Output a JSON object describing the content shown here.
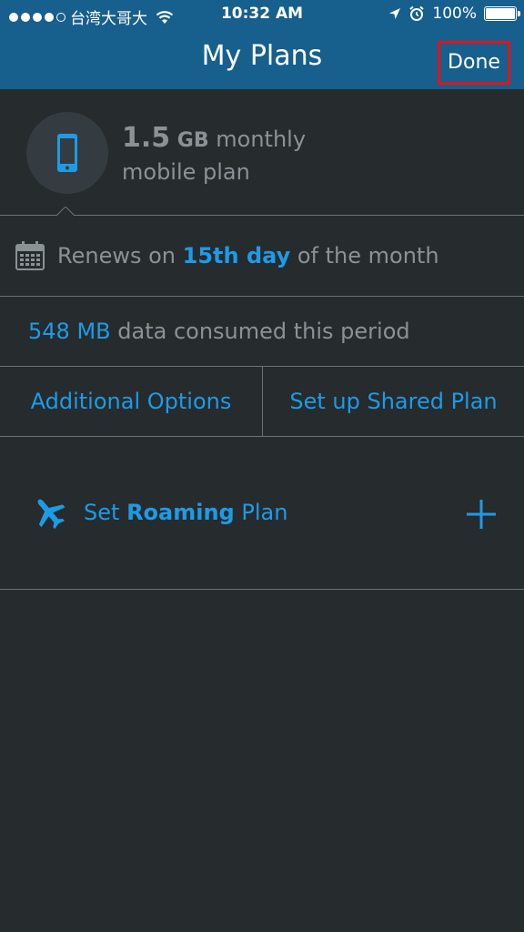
{
  "status_bar": {
    "carrier": "台湾大哥大",
    "time": "10:32 AM",
    "battery": "100%"
  },
  "nav": {
    "title": "My Plans",
    "done_label": "Done"
  },
  "plan": {
    "amount": "1.5",
    "unit": "GB",
    "monthly": "monthly",
    "line2": "mobile plan"
  },
  "renews": {
    "prefix": "Renews on",
    "day": "15th day",
    "suffix": "of the month"
  },
  "consumed": {
    "amount": "548 MB",
    "text": "data consumed this period"
  },
  "options": {
    "additional": "Additional Options",
    "shared": "Set up Shared Plan"
  },
  "roaming": {
    "prefix": "Set",
    "bold": "Roaming",
    "suffix": "Plan"
  },
  "colors": {
    "nav_bg": "#175f8c",
    "body_bg": "#262b2e",
    "accent": "#1e9be6",
    "highlight_border": "#e0141d"
  },
  "icons": {
    "phone": "smartphone-icon",
    "calendar": "calendar-icon",
    "plane": "airplane-icon",
    "plus": "plus-icon",
    "wifi": "wifi-icon",
    "location": "location-arrow-icon",
    "alarm": "alarm-icon",
    "battery": "battery-icon"
  }
}
